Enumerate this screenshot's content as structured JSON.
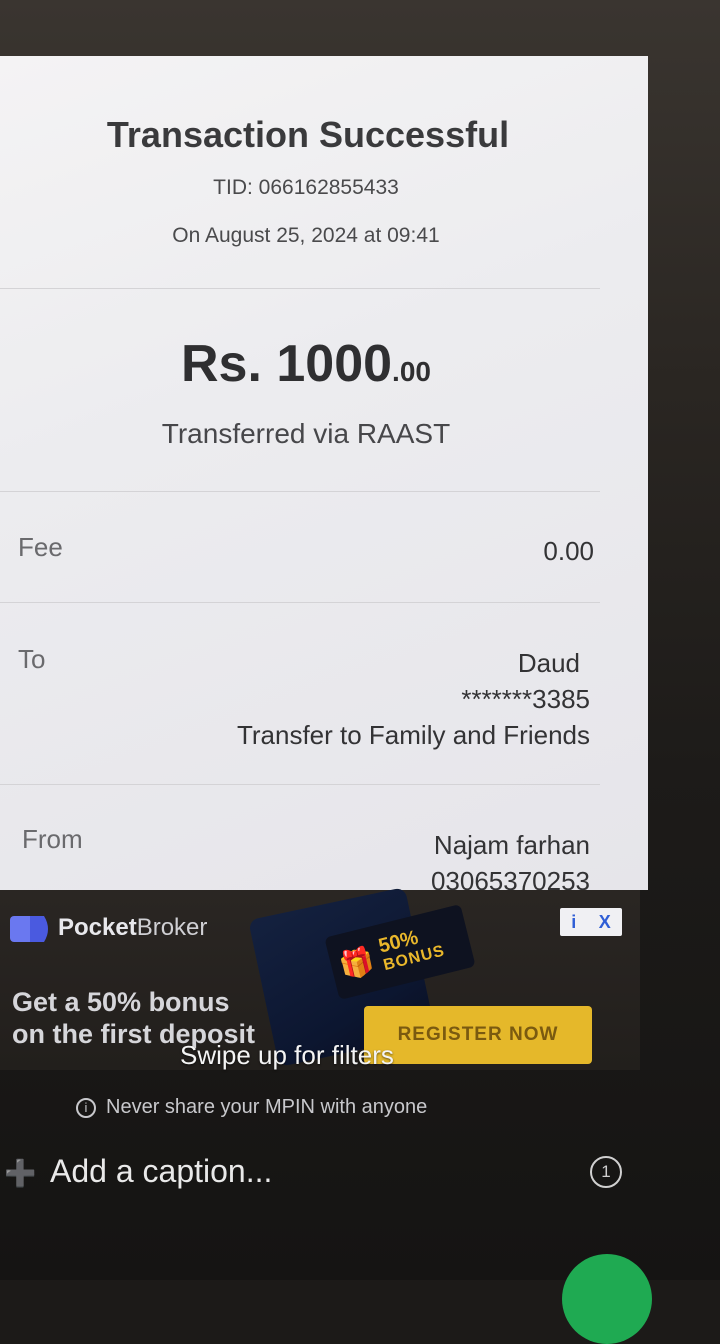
{
  "receipt": {
    "title": "Transaction Successful",
    "tid": "TID: 066162855433",
    "date": "On August 25, 2024 at 09:41",
    "amount_main": "Rs. 1000",
    "amount_decimal": ".00",
    "transfer_method": "Transferred via RAAST",
    "fee_label": "Fee",
    "fee_value": "0.00",
    "to_label": "To",
    "to_name": "Daud",
    "to_account": "*******3385",
    "to_purpose": "Transfer to Family and Friends",
    "from_label": "From",
    "from_name": "Najam farhan",
    "from_number": "03065370253"
  },
  "ad": {
    "brand_bold": "Pocket",
    "brand_thin": "Broker",
    "headline_line1": "Get a 50% bonus",
    "headline_line2": "on the first deposit",
    "bonus_percent": "50%",
    "bonus_word": "BONUS",
    "cta": "REGISTER NOW",
    "info_glyph": "i",
    "close_glyph": "X"
  },
  "viewer": {
    "swipe_hint": "Swipe up for filters",
    "security_note": "Never share your MPIN with anyone",
    "caption_placeholder": "Add a caption...",
    "view_once_label": "1"
  },
  "colors": {
    "register_button": "#e5b82a",
    "send_button": "#1faa52",
    "ad_close": "#2f5ed6"
  }
}
